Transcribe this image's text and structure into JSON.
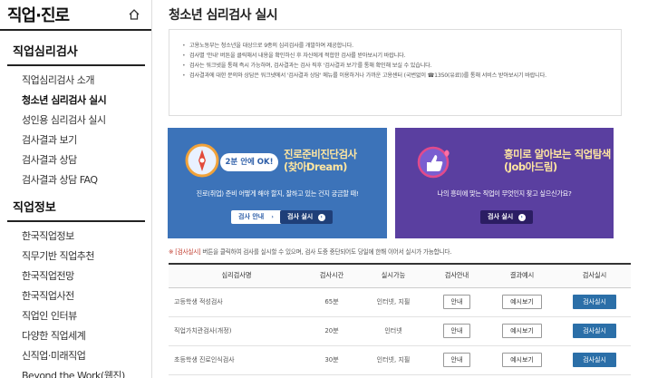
{
  "sidebar": {
    "title": "직업·진로",
    "sections": [
      {
        "title": "직업심리검사",
        "items": [
          "직업심리검사 소개",
          "청소년 심리검사 실시",
          "성인용 심리검사 실시",
          "검사결과 보기",
          "검사결과 상담",
          "검사결과 상담 FAQ"
        ]
      },
      {
        "title": "직업정보",
        "items": [
          "한국직업정보",
          "직무기반 직업추천",
          "한국직업전망",
          "한국직업사전",
          "직업인 인터뷰",
          "다양한 직업세계",
          "신직업·미래직업",
          "Beyond the Work(웹진)"
        ]
      }
    ]
  },
  "main": {
    "title": "청소년 심리검사 실시",
    "notices": [
      "고용노동부는 청소년을 대상으로 9종의 심리검사를 개발하여 제공합니다.",
      "검사별 '안내' 버튼을 클릭해서 내용을 확인하신 후 자신에게 적합한 검사를 받아보시기 바랍니다.",
      "검사는 워크넷을 통해 즉시 가능하며, 검사결과는 검사 직후 '검사결과 보기'를 통해 확인해 보실 수 있습니다.",
      "검사결과에 대한 문의와 상담은 워크넷에서 '검사결과 상담' 메뉴를 이용하거나 가까운 고용센터 (국번없이 ☎1350(유료))를 통해 서비스 받아보시기 바랍니다."
    ],
    "banners": [
      {
        "title_line1": "진로준비진단검사",
        "title_line2": "(찾아Dream)",
        "badge": "2분 안에 OK!",
        "desc": "진로(취업) 준비 어떻게 해야 할지, 잘하고 있는 건지 궁금할 때!",
        "btn_info": "검사 안내",
        "btn_start": "검사 실시"
      },
      {
        "title_line1": "흥미로 알아보는 직업탐색",
        "title_line2": "(Job아드림)",
        "desc": "나의 흥미에 맞는 직업이 무엇인지 찾고 싶으신가요?",
        "btn_start": "검사 실시"
      }
    ],
    "hint_mark": "※ [검사실시]",
    "hint_text": " 버튼을 클릭하여 검사를 실시할 수 있으며, 검사 도중 중단되어도 당일에 한해 이어서 실시가 가능합니다.",
    "table": {
      "headers": [
        "심리검사명",
        "검사시간",
        "실시가능",
        "검사안내",
        "결과예시",
        "검사실시"
      ],
      "rows": [
        {
          "name": "고등학생 적성검사",
          "time": "65분",
          "mode": "인터넷, 지필",
          "info": "안내",
          "example": "예시보기",
          "start": "검사실시"
        },
        {
          "name": "직업가치관검사(개정)",
          "time": "20분",
          "mode": "인터넷",
          "info": "안내",
          "example": "예시보기",
          "start": "검사실시"
        },
        {
          "name": "초등학생 진로인식검사",
          "time": "30분",
          "mode": "인터넷, 지필",
          "info": "안내",
          "example": "예시보기",
          "start": "검사실시"
        }
      ]
    }
  },
  "colors": {
    "banner_blue": "#3c73b9",
    "banner_purple": "#5a3fa0",
    "action_button": "#2b6fa8",
    "hint_red": "#c0392b"
  },
  "icons": [
    "home-icon",
    "compass-icon",
    "thumbs-up-icon",
    "heart-icon"
  ]
}
